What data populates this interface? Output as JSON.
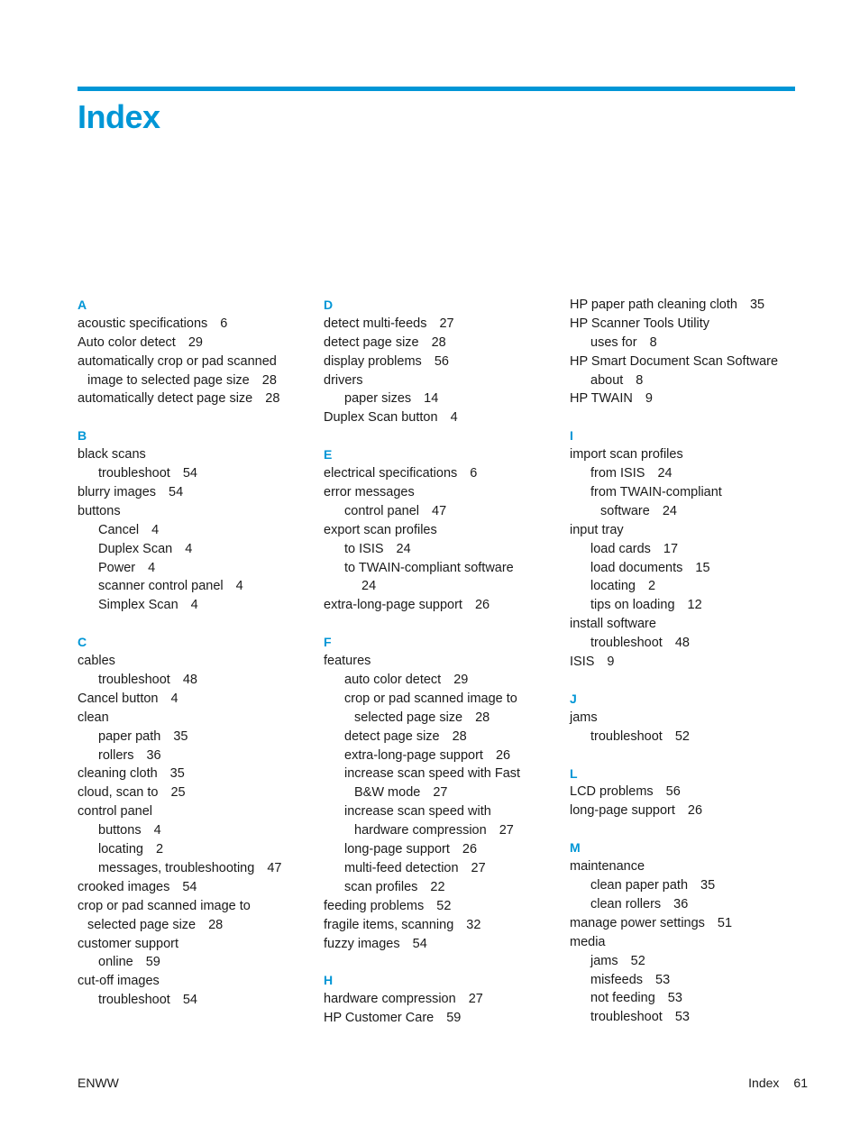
{
  "header": {
    "title": "Index",
    "accent_color": "#0096d6"
  },
  "columns": [
    {
      "sections": [
        {
          "letter": "A",
          "entries": [
            {
              "term": "acoustic specifications",
              "page": "6"
            },
            {
              "term": "Auto color detect",
              "page": "29"
            },
            {
              "term": "automatically crop or pad scanned",
              "cont": "image to selected page size",
              "page": "28"
            },
            {
              "term": "automatically detect page size",
              "page": "28"
            }
          ]
        },
        {
          "letter": "B",
          "entries": [
            {
              "term": "black scans",
              "subs": [
                {
                  "term": "troubleshoot",
                  "page": "54"
                }
              ]
            },
            {
              "term": "blurry images",
              "page": "54"
            },
            {
              "term": "buttons",
              "subs": [
                {
                  "term": "Cancel",
                  "page": "4"
                },
                {
                  "term": "Duplex Scan",
                  "page": "4"
                },
                {
                  "term": "Power",
                  "page": "4"
                },
                {
                  "term": "scanner control panel",
                  "page": "4"
                },
                {
                  "term": "Simplex Scan",
                  "page": "4"
                }
              ]
            }
          ]
        },
        {
          "letter": "C",
          "entries": [
            {
              "term": "cables",
              "subs": [
                {
                  "term": "troubleshoot",
                  "page": "48"
                }
              ]
            },
            {
              "term": "Cancel button",
              "page": "4"
            },
            {
              "term": "clean",
              "subs": [
                {
                  "term": "paper path",
                  "page": "35"
                },
                {
                  "term": "rollers",
                  "page": "36"
                }
              ]
            },
            {
              "term": "cleaning cloth",
              "page": "35"
            },
            {
              "term": "cloud, scan to",
              "page": "25"
            },
            {
              "term": "control panel",
              "subs": [
                {
                  "term": "buttons",
                  "page": "4"
                },
                {
                  "term": "locating",
                  "page": "2"
                },
                {
                  "term": "messages, troubleshooting",
                  "page": "47"
                }
              ]
            },
            {
              "term": "crooked images",
              "page": "54"
            },
            {
              "term": "crop or pad scanned image to",
              "cont": "selected page size",
              "page": "28"
            },
            {
              "term": "customer support",
              "subs": [
                {
                  "term": "online",
                  "page": "59"
                }
              ]
            },
            {
              "term": "cut-off images",
              "subs": [
                {
                  "term": "troubleshoot",
                  "page": "54"
                }
              ]
            }
          ]
        }
      ]
    },
    {
      "sections": [
        {
          "letter": "D",
          "entries": [
            {
              "term": "detect multi-feeds",
              "page": "27"
            },
            {
              "term": "detect page size",
              "page": "28"
            },
            {
              "term": "display problems",
              "page": "56"
            },
            {
              "term": "drivers",
              "subs": [
                {
                  "term": "paper sizes",
                  "page": "14"
                }
              ]
            },
            {
              "term": "Duplex Scan button",
              "page": "4"
            }
          ]
        },
        {
          "letter": "E",
          "entries": [
            {
              "term": "electrical specifications",
              "page": "6"
            },
            {
              "term": "error messages",
              "subs": [
                {
                  "term": "control panel",
                  "page": "47"
                }
              ]
            },
            {
              "term": "export scan profiles",
              "subs": [
                {
                  "term": "to ISIS",
                  "page": "24"
                },
                {
                  "term": "to TWAIN-compliant software",
                  "cont": "",
                  "page": "24"
                }
              ]
            },
            {
              "term": "extra-long-page support",
              "page": "26"
            }
          ]
        },
        {
          "letter": "F",
          "entries": [
            {
              "term": "features",
              "subs": [
                {
                  "term": "auto color detect",
                  "page": "29"
                },
                {
                  "term": "crop or pad scanned image to",
                  "cont": "selected page size",
                  "page": "28"
                },
                {
                  "term": "detect page size",
                  "page": "28"
                },
                {
                  "term": "extra-long-page support",
                  "page": "26"
                },
                {
                  "term": "increase scan speed with Fast",
                  "cont": "B&W mode",
                  "page": "27"
                },
                {
                  "term": "increase scan speed with",
                  "cont": "hardware compression",
                  "page": "27"
                },
                {
                  "term": "long-page support",
                  "page": "26"
                },
                {
                  "term": "multi-feed detection",
                  "page": "27"
                },
                {
                  "term": "scan profiles",
                  "page": "22"
                }
              ]
            },
            {
              "term": "feeding problems",
              "page": "52"
            },
            {
              "term": "fragile items, scanning",
              "page": "32"
            },
            {
              "term": "fuzzy images",
              "page": "54"
            }
          ]
        },
        {
          "letter": "H",
          "entries": [
            {
              "term": "hardware compression",
              "page": "27"
            },
            {
              "term": "HP Customer Care",
              "page": "59"
            }
          ]
        }
      ]
    },
    {
      "sections": [
        {
          "letter": "",
          "entries": [
            {
              "term": "HP paper path cleaning cloth",
              "page": "35"
            },
            {
              "term": "HP Scanner Tools Utility",
              "subs": [
                {
                  "term": "uses for",
                  "page": "8"
                }
              ]
            },
            {
              "term": "HP Smart Document Scan Software",
              "subs": [
                {
                  "term": "about",
                  "page": "8"
                }
              ]
            },
            {
              "term": "HP TWAIN",
              "page": "9"
            }
          ]
        },
        {
          "letter": "I",
          "entries": [
            {
              "term": "import scan profiles",
              "subs": [
                {
                  "term": "from ISIS",
                  "page": "24"
                },
                {
                  "term": "from TWAIN-compliant",
                  "cont": "software",
                  "page": "24"
                }
              ]
            },
            {
              "term": "input tray",
              "subs": [
                {
                  "term": "load cards",
                  "page": "17"
                },
                {
                  "term": "load documents",
                  "page": "15"
                },
                {
                  "term": "locating",
                  "page": "2"
                },
                {
                  "term": "tips on loading",
                  "page": "12"
                }
              ]
            },
            {
              "term": "install software",
              "subs": [
                {
                  "term": "troubleshoot",
                  "page": "48"
                }
              ]
            },
            {
              "term": "ISIS",
              "page": "9"
            }
          ]
        },
        {
          "letter": "J",
          "entries": [
            {
              "term": "jams",
              "subs": [
                {
                  "term": "troubleshoot",
                  "page": "52"
                }
              ]
            }
          ]
        },
        {
          "letter": "L",
          "entries": [
            {
              "term": "LCD problems",
              "page": "56"
            },
            {
              "term": "long-page support",
              "page": "26"
            }
          ]
        },
        {
          "letter": "M",
          "entries": [
            {
              "term": "maintenance",
              "subs": [
                {
                  "term": "clean paper path",
                  "page": "35"
                },
                {
                  "term": "clean rollers",
                  "page": "36"
                }
              ]
            },
            {
              "term": "manage power settings",
              "page": "51"
            },
            {
              "term": "media",
              "subs": [
                {
                  "term": "jams",
                  "page": "52"
                },
                {
                  "term": "misfeeds",
                  "page": "53"
                },
                {
                  "term": "not feeding",
                  "page": "53"
                },
                {
                  "term": "troubleshoot",
                  "page": "53"
                }
              ]
            }
          ]
        }
      ]
    }
  ],
  "footer": {
    "left": "ENWW",
    "section": "Index",
    "page_number": "61"
  }
}
